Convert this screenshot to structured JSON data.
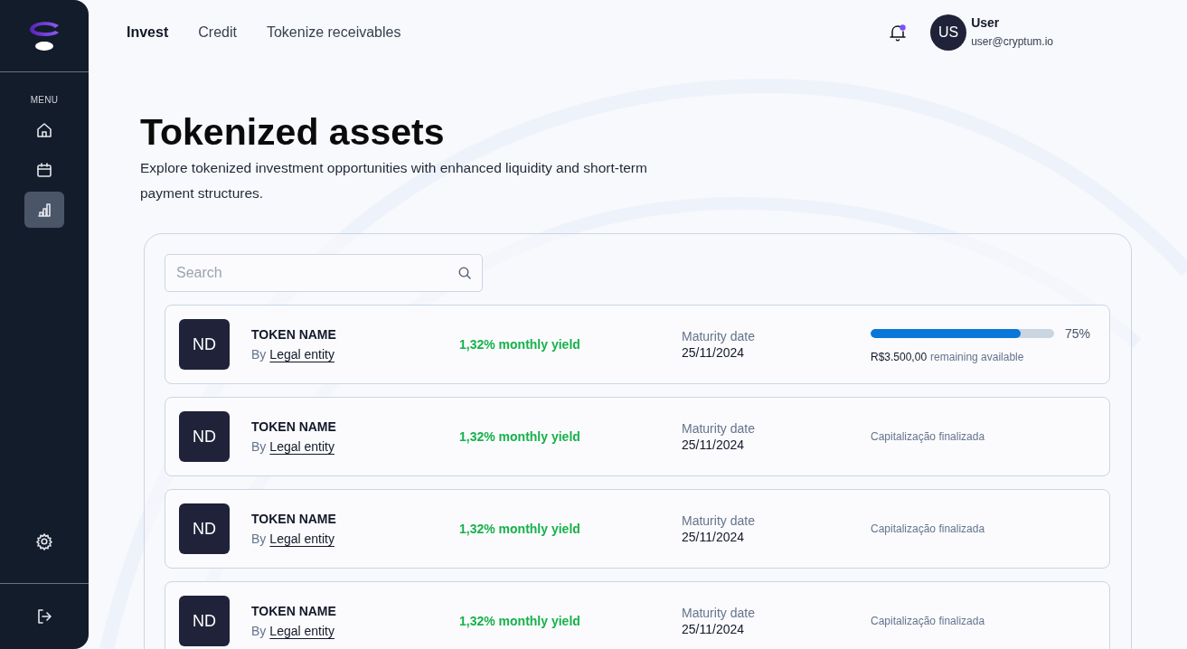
{
  "sidebar": {
    "section_label": "MENU",
    "items": [
      {
        "selected": false
      },
      {
        "selected": false
      },
      {
        "selected": true
      }
    ]
  },
  "nav": {
    "tabs": [
      {
        "label": "Invest",
        "selected": true
      },
      {
        "label": "Credit",
        "selected": false
      },
      {
        "label": "Tokenize receivables",
        "selected": false
      }
    ]
  },
  "header": {
    "notifications_unread": true,
    "user": {
      "initials": "US",
      "name": "User",
      "email": "user@cryptum.io"
    }
  },
  "page": {
    "title": "Tokenized assets",
    "description": "Explore tokenized investment opportunities with enhanced liquidity and short-term payment structures."
  },
  "search": {
    "placeholder": "Search"
  },
  "assets": [
    {
      "kind": "progress",
      "initials": "ND",
      "name": "TOKEN NAME",
      "by": "By",
      "issuer": "Legal entity",
      "yield": "1,32% monthly yield",
      "maturity_label": "Maturity date",
      "maturity": "25/11/2024",
      "level": 0.82,
      "percent": "75%",
      "amount": "R$3.500,00",
      "amount_note": "remaining available"
    },
    {
      "kind": "closed",
      "initials": "ND",
      "name": "TOKEN NAME",
      "by": "By",
      "issuer": "Legal entity",
      "yield": "1,32% monthly yield",
      "maturity_label": "Maturity date",
      "maturity": "25/11/2024",
      "status": "Capitalização finalizada"
    },
    {
      "kind": "closed",
      "initials": "ND",
      "name": "TOKEN NAME",
      "by": "By",
      "issuer": "Legal entity",
      "yield": "1,32% monthly yield",
      "maturity_label": "Maturity date",
      "maturity": "25/11/2024",
      "status": "Capitalização finalizada"
    },
    {
      "kind": "closed",
      "initials": "ND",
      "name": "TOKEN NAME",
      "by": "By",
      "issuer": "Legal entity",
      "yield": "1,32% monthly yield",
      "maturity_label": "Maturity date",
      "maturity": "25/11/2024",
      "status": "Capitalização finalizada"
    }
  ]
}
